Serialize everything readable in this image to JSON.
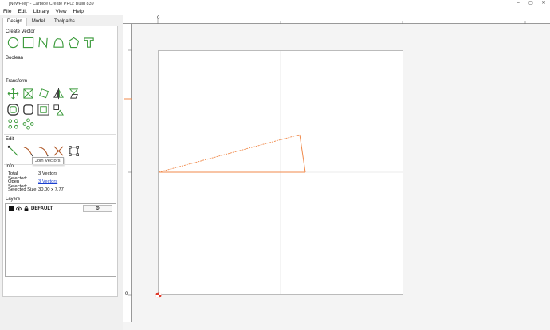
{
  "window": {
    "title": "[NewFile]* - Carbide Create PRO: Build 839",
    "minimize": "–",
    "maximize": "▢",
    "close": "✕"
  },
  "menu": {
    "items": [
      "File",
      "Edit",
      "Library",
      "View",
      "Help"
    ]
  },
  "tabs": [
    {
      "label": "Design",
      "active": true
    },
    {
      "label": "Model",
      "active": false
    },
    {
      "label": "Toolpaths",
      "active": false
    }
  ],
  "sections": {
    "create_vector": "Create Vector",
    "boolean": "Boolean",
    "transform": "Transform",
    "edit": "Edit",
    "info": "Info",
    "layers": "Layers"
  },
  "icons": {
    "create": [
      "circle-icon",
      "rectangle-icon",
      "polyline-icon",
      "curve-icon",
      "polygon-icon",
      "text-icon"
    ],
    "transform_row1": [
      "move-icon",
      "scale-icon",
      "rotate-icon",
      "mirror-icon",
      "shear-icon"
    ],
    "transform_row2": [
      "offset-icon",
      "fillet-icon",
      "align-icon",
      "distribute-icon"
    ],
    "transform_row3": [
      "grid-array-icon",
      "circular-array-icon"
    ],
    "edit": [
      "node-edit-icon",
      "join-vectors-icon",
      "join-close-icon",
      "trim-icon",
      "bounding-box-icon"
    ]
  },
  "tooltip": "Join Vectors",
  "info": {
    "total_label": "Total Selected:",
    "total_value": "3 Vectors",
    "open_label": "Open Selected:",
    "open_value": "3 Vectors",
    "size_label": "Selected Size:",
    "size_value": "30.00 x 7.77"
  },
  "layers": {
    "name": "DEFAULT",
    "gear": "⚙"
  },
  "rulers": {
    "top_zero": "0",
    "left_zero": "0"
  },
  "colors": {
    "accent": "#f08a4b",
    "icon_green": "#3a9a3a",
    "origin": "#e03a2a"
  }
}
